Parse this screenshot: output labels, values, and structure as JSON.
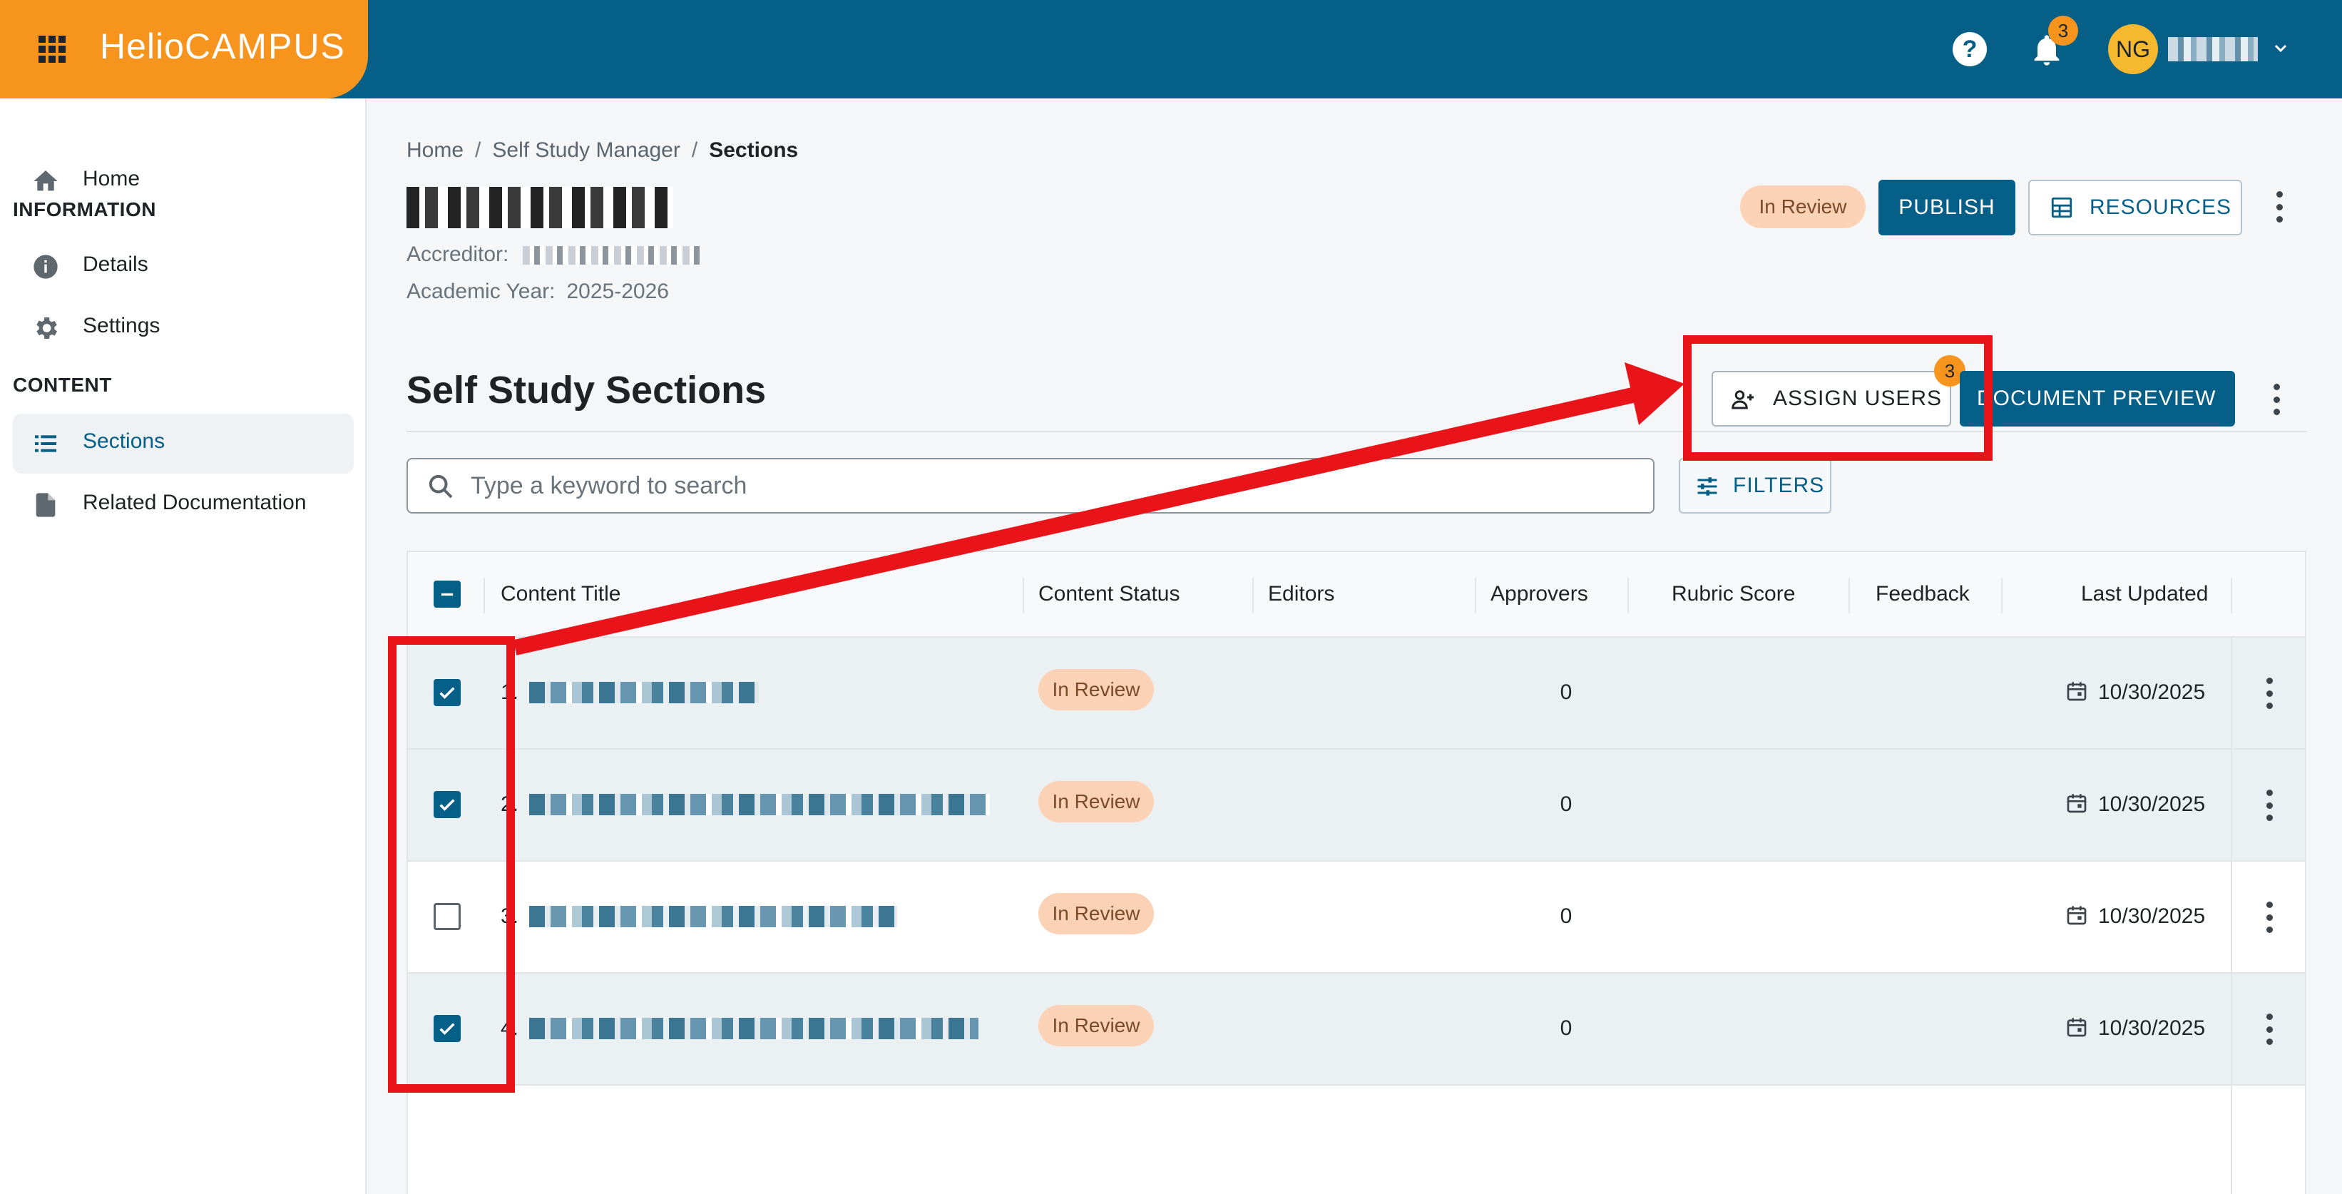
{
  "header": {
    "logo_primary": "Helio",
    "logo_secondary": "CAMPUS",
    "notification_count": "3",
    "user_initials": "NG"
  },
  "sidebar": {
    "items": [
      {
        "label": "Home",
        "icon": "home-icon"
      },
      {
        "label": "Details",
        "icon": "info-icon"
      },
      {
        "label": "Settings",
        "icon": "gear-icon"
      },
      {
        "label": "Sections",
        "icon": "list-icon"
      },
      {
        "label": "Related Documentation",
        "icon": "document-icon"
      }
    ],
    "section_information": "INFORMATION",
    "section_content": "CONTENT",
    "active_item": "Sections"
  },
  "breadcrumb": {
    "home": "Home",
    "manager": "Self Study Manager",
    "current": "Sections"
  },
  "study": {
    "accreditor_label": "Accreditor:",
    "year_label": "Academic Year:",
    "year_value": "2025-2026",
    "status": "In Review"
  },
  "actions": {
    "publish": "PUBLISH",
    "resources": "RESOURCES",
    "assign_users": "ASSIGN USERS",
    "assign_badge": "3",
    "document_preview": "DOCUMENT PREVIEW",
    "filters": "FILTERS"
  },
  "sections": {
    "title": "Self Study Sections",
    "search_placeholder": "Type a keyword to search"
  },
  "table": {
    "columns": [
      "Content Title",
      "Content Status",
      "Editors",
      "Approvers",
      "Rubric Score",
      "Feedback",
      "Last Updated"
    ],
    "rows": [
      {
        "num": "1.",
        "status": "In Review",
        "approvers": "0",
        "updated": "10/30/2025",
        "checked": true
      },
      {
        "num": "2.",
        "status": "In Review",
        "approvers": "0",
        "updated": "10/30/2025",
        "checked": true
      },
      {
        "num": "3.",
        "status": "In Review",
        "approvers": "0",
        "updated": "10/30/2025",
        "checked": false
      },
      {
        "num": "4.",
        "status": "In Review",
        "approvers": "0",
        "updated": "10/30/2025",
        "checked": true
      }
    ]
  },
  "colors": {
    "header_blue": "#055f86",
    "brand_orange": "#f7941d",
    "status_chip": "#fcd2b6",
    "annotation_red": "#e8141a"
  }
}
